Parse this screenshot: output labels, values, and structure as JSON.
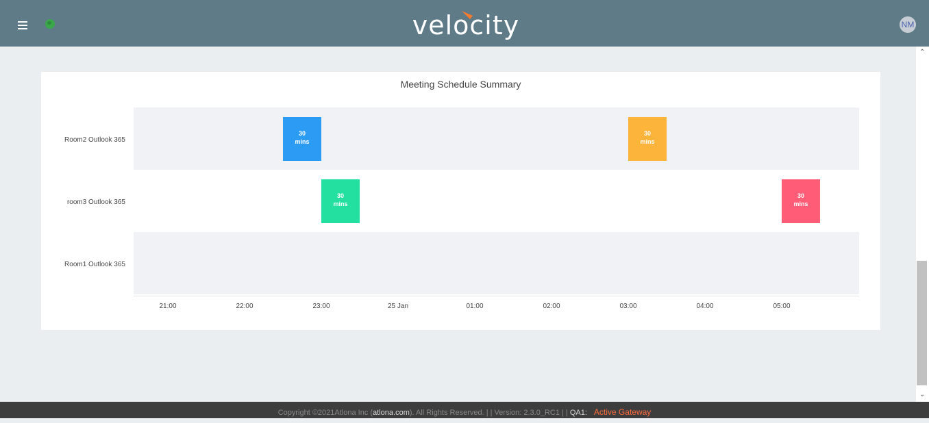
{
  "header": {
    "brand": "velocity",
    "avatar_initials": "NM",
    "menu_icon": "hamburger-menu-icon",
    "status_icon": "globe-icon",
    "brand_color": "#5f7b88"
  },
  "schedule": {
    "title": "Meeting Schedule Summary",
    "rooms": [
      "Room2 Outlook 365",
      "room3 Outlook 365",
      "Room1 Outlook 365"
    ],
    "ticks": [
      "21:00",
      "22:00",
      "23:00",
      "25 Jan",
      "01:00",
      "02:00",
      "03:00",
      "04:00",
      "05:00"
    ],
    "meetings": [
      {
        "room": "Room2 Outlook 365",
        "start": "22:30",
        "duration_min": 30,
        "label_num": "30",
        "label_unit": "mins",
        "color": "#2b9bf4"
      },
      {
        "room": "Room2 Outlook 365",
        "start": "03:00",
        "duration_min": 30,
        "label_num": "30",
        "label_unit": "mins",
        "color": "#fcb43a"
      },
      {
        "room": "room3 Outlook 365",
        "start": "23:00",
        "duration_min": 30,
        "label_num": "30",
        "label_unit": "mins",
        "color": "#23e0a0"
      },
      {
        "room": "room3 Outlook 365",
        "start": "05:00",
        "duration_min": 30,
        "label_num": "30",
        "label_unit": "mins",
        "color": "#ff5c78"
      }
    ]
  },
  "footer": {
    "copyright_prefix": "Copyright ©2021Atlona Inc (",
    "link": "atlona.com",
    "copyright_suffix": "). All Rights Reserved. | | Version: 2.3.0_RC1 | | ",
    "qa": "QA1:",
    "gateway": "Active Gateway",
    "gateway_color": "#ff6b3d"
  }
}
